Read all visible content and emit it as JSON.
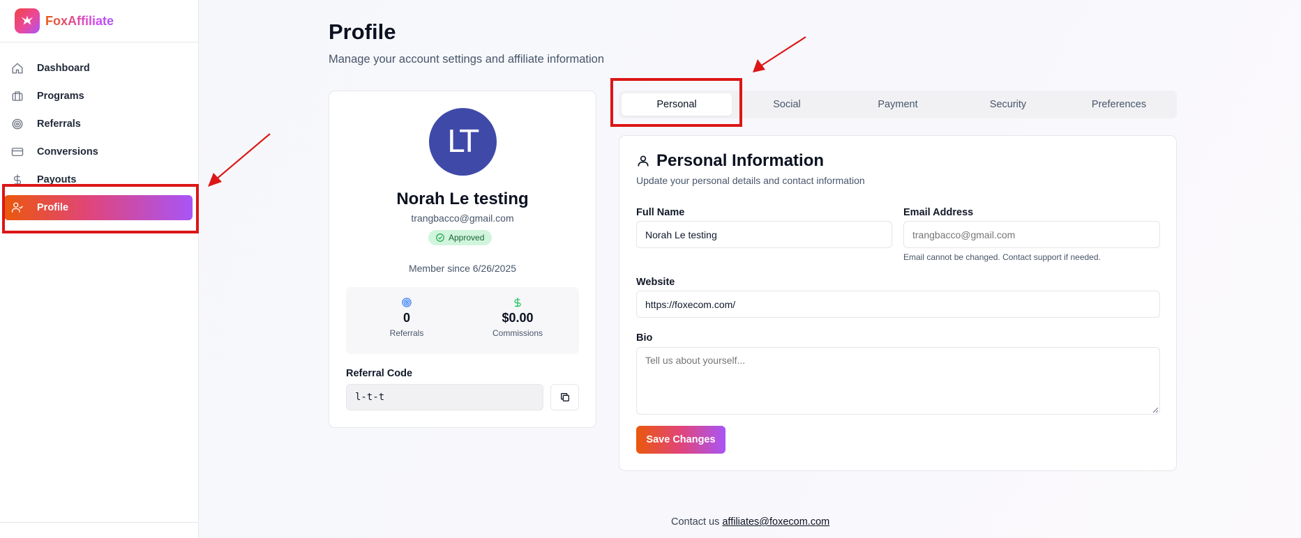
{
  "brand": {
    "name": "FoxAffiliate"
  },
  "sidebar": {
    "items": [
      {
        "label": "Dashboard",
        "icon": "home-icon"
      },
      {
        "label": "Programs",
        "icon": "briefcase-icon"
      },
      {
        "label": "Referrals",
        "icon": "target-icon"
      },
      {
        "label": "Conversions",
        "icon": "credit-card-icon"
      },
      {
        "label": "Payouts",
        "icon": "dollar-icon"
      },
      {
        "label": "Profile",
        "icon": "user-check-icon",
        "active": true
      }
    ]
  },
  "header": {
    "title": "Profile",
    "subtitle": "Manage your account settings and affiliate information"
  },
  "profile": {
    "initials": "LT",
    "name": "Norah Le testing",
    "email": "trangbacco@gmail.com",
    "status": "Approved",
    "member_since": "Member since 6/26/2025",
    "stats": {
      "referrals_value": "0",
      "referrals_label": "Referrals",
      "commissions_value": "$0.00",
      "commissions_label": "Commissions"
    },
    "referral_code_label": "Referral Code",
    "referral_code": "l-t-t"
  },
  "tabs": [
    {
      "label": "Personal",
      "active": true
    },
    {
      "label": "Social"
    },
    {
      "label": "Payment"
    },
    {
      "label": "Security"
    },
    {
      "label": "Preferences"
    }
  ],
  "personal": {
    "title": "Personal Information",
    "subtitle": "Update your personal details and contact information",
    "full_name_label": "Full Name",
    "full_name_value": "Norah Le testing",
    "email_label": "Email Address",
    "email_placeholder": "trangbacco@gmail.com",
    "email_hint": "Email cannot be changed. Contact support if needed.",
    "website_label": "Website",
    "website_value": "https://foxecom.com/",
    "bio_label": "Bio",
    "bio_placeholder": "Tell us about yourself...",
    "save_label": "Save Changes"
  },
  "footer": {
    "text": "Contact us",
    "email": "affiliates@foxecom.com"
  },
  "colors": {
    "accent_start": "#ea580c",
    "accent_end": "#a855f7",
    "annotation_red": "#dc1616",
    "avatar_bg": "#3f4aa8",
    "approved_bg": "#d1f5dc"
  }
}
